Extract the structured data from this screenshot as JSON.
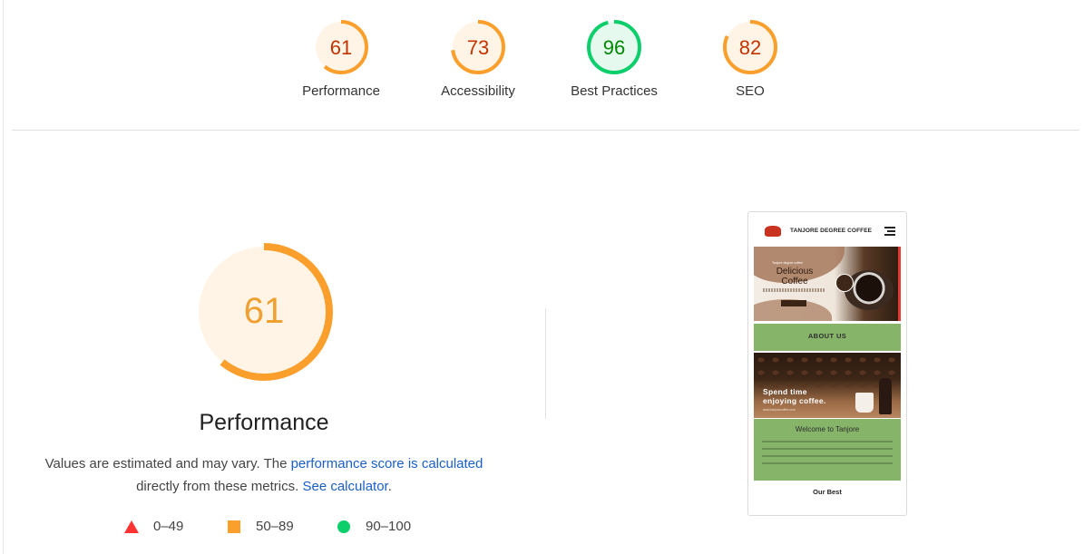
{
  "gauges": [
    {
      "score": "61",
      "label": "Performance",
      "value": 0.61,
      "color": "#fa9f2b",
      "fill": "#fff4e6",
      "text_color": "#c33300"
    },
    {
      "score": "73",
      "label": "Accessibility",
      "value": 0.73,
      "color": "#fa9f2b",
      "fill": "#fff4e6",
      "text_color": "#c33300"
    },
    {
      "score": "96",
      "label": "Best Practices",
      "value": 0.96,
      "color": "#0cce6b",
      "fill": "#e6f9ef",
      "text_color": "#008800"
    },
    {
      "score": "82",
      "label": "SEO",
      "value": 0.82,
      "color": "#fa9f2b",
      "fill": "#fff4e6",
      "text_color": "#c33300"
    }
  ],
  "main": {
    "score": "61",
    "value": 0.61,
    "title": "Performance",
    "desc_prefix": "Values are estimated and may vary. The ",
    "desc_link": "performance score is calculated",
    "desc_middle": " directly from these metrics. ",
    "desc_link2": "See calculator",
    "desc_suffix": "."
  },
  "legend": [
    {
      "range": "0–49",
      "shape": "triangle-icon",
      "color": "#ff3333"
    },
    {
      "range": "50–89",
      "shape": "square-icon",
      "color": "#fa9f2b"
    },
    {
      "range": "90–100",
      "shape": "circle-icon",
      "color": "#0cce6b"
    }
  ],
  "screenshot": {
    "brand": "TANJORE DEGREE COFFEE",
    "hero_small": "Tanjore degree coffee",
    "hero_title_1": "Delicious",
    "hero_title_2": "Coffee",
    "about": "ABOUT US",
    "spend_1": "Spend time",
    "spend_2": "enjoying coffee.",
    "url": "www.tanjorecoffee.com",
    "welcome": "Welcome to Tanjore",
    "our_best": "Our Best"
  }
}
